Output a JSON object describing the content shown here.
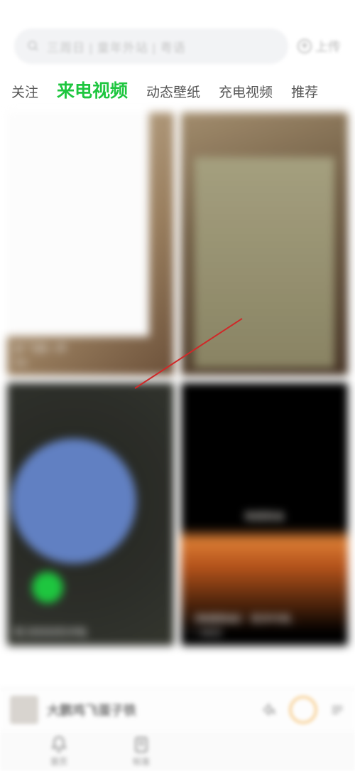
{
  "search": {
    "placeholder": "三周日 | 童年外站 | 粤语"
  },
  "upload": {
    "label": "上传"
  },
  "tabs": [
    {
      "label": "关注",
      "active": false
    },
    {
      "label": "来电视频",
      "active": true
    },
    {
      "label": "动态壁纸",
      "active": false
    },
    {
      "label": "充电视频",
      "active": false
    },
    {
      "label": "推荐",
      "active": false
    }
  ],
  "cards": [
    {
      "title": "好 飞扬一声",
      "count": "2w"
    },
    {
      "title": "",
      "count": ""
    },
    {
      "title": "呢 好好好的冲电",
      "count": ""
    },
    {
      "title": "《晚霞歌曲》 很多时候..",
      "count": "5422",
      "mid_text": "晚霞歌曲"
    }
  ],
  "player": {
    "track": "大鹏鸡飞蛋子铁"
  },
  "bottom_nav": [
    {
      "label": "首页"
    },
    {
      "label": "标准"
    }
  ]
}
